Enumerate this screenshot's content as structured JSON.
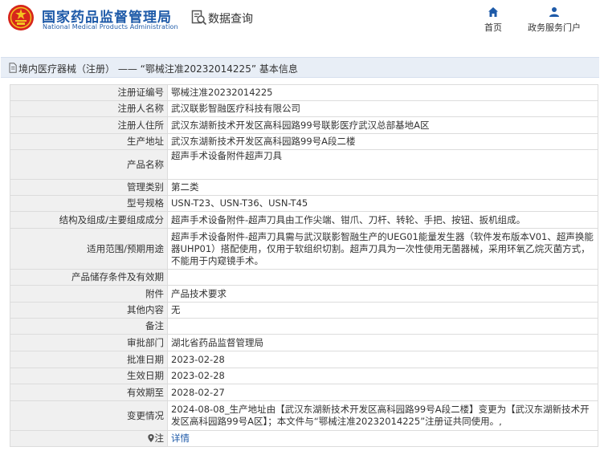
{
  "header": {
    "site_name": "国家药品监督管理局",
    "site_name_en": "National Medical Products Administration",
    "query_title": "数据查询",
    "nav": [
      {
        "label": "首页",
        "icon": "home-icon"
      },
      {
        "label": "政务服务门户",
        "icon": "user-icon"
      }
    ]
  },
  "breadcrumb": {
    "text": "境内医疗器械（注册） ——  “鄂械注准20232014225” 基本信息"
  },
  "table": {
    "rows": [
      {
        "label": "注册证编号",
        "value": "鄂械注准20232014225"
      },
      {
        "label": "注册人名称",
        "value": "武汉联影智融医疗科技有限公司"
      },
      {
        "label": "注册人住所",
        "value": "武汉东湖新技术开发区高科园路99号联影医疗武汉总部基地A区"
      },
      {
        "label": "生产地址",
        "value": "武汉东湖新技术开发区高科园路99号A段二楼"
      },
      {
        "label": "产品名称",
        "value": "超声手术设备附件超声刀具"
      },
      {
        "label": "管理类别",
        "value": "第二类"
      },
      {
        "label": "型号规格",
        "value": "USN-T23、USN-T36、USN-T45"
      },
      {
        "label": "结构及组成/主要组成成分",
        "value": "超声手术设备附件-超声刀具由工作尖端、钳爪、刀杆、转轮、手把、按钮、扳机组成。"
      },
      {
        "label": "适用范围/预期用途",
        "value": "超声手术设备附件-超声刀具需与武汉联影智融生产的UEG01能量发生器（软件发布版本V01、超声换能器UHP01）搭配使用，仅用于软组织切割。超声刀具为一次性使用无菌器械，采用环氧乙烷灭菌方式，不能用于内窥镜手术。"
      },
      {
        "label": "产品储存条件及有效期",
        "value": ""
      },
      {
        "label": "附件",
        "value": "产品技术要求"
      },
      {
        "label": "其他内容",
        "value": "无"
      },
      {
        "label": "备注",
        "value": ""
      },
      {
        "label": "审批部门",
        "value": "湖北省药品监督管理局"
      },
      {
        "label": "批准日期",
        "value": "2023-02-28"
      },
      {
        "label": "生效日期",
        "value": "2023-02-28"
      },
      {
        "label": "有效期至",
        "value": "2028-02-27"
      },
      {
        "label": "变更情况",
        "value": "2024-08-08_生产地址由【武汉东湖新技术开发区高科园路99号A段二楼】变更为【武汉东湖新技术开发区高科园路99号A区】；本文件与“鄂械注准20232014225”注册证共同使用。,"
      }
    ],
    "note_row": {
      "label": "注",
      "value": "详情"
    }
  },
  "colors": {
    "brand_blue": "#1e5aa8",
    "logo_red": "#d7261c",
    "logo_gold": "#f3c320",
    "label_bg": "#f0f0f0",
    "title_bar_bg": "#e8eef6",
    "border": "#dcdcdc"
  }
}
